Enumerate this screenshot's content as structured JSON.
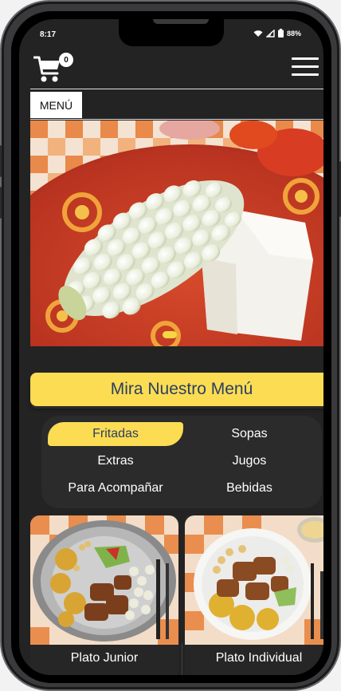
{
  "status_bar": {
    "time": "8:17",
    "battery": "88%"
  },
  "header": {
    "cart_count": "0"
  },
  "nav": {
    "menu_label": "MENÚ"
  },
  "cta": {
    "label": "Mira Nuestro Menú"
  },
  "categories": [
    {
      "label": "Fritadas",
      "active": true
    },
    {
      "label": "Sopas",
      "active": false
    },
    {
      "label": "Extras",
      "active": false
    },
    {
      "label": "Jugos",
      "active": false
    },
    {
      "label": "Para Acompañar",
      "active": false
    },
    {
      "label": "Bebidas",
      "active": false
    }
  ],
  "products": [
    {
      "name": "Plato Junior"
    },
    {
      "name": "Plato Individual"
    }
  ],
  "colors": {
    "accent": "#fbdc53",
    "accent_text": "#2b3f61",
    "background": "#232323"
  }
}
